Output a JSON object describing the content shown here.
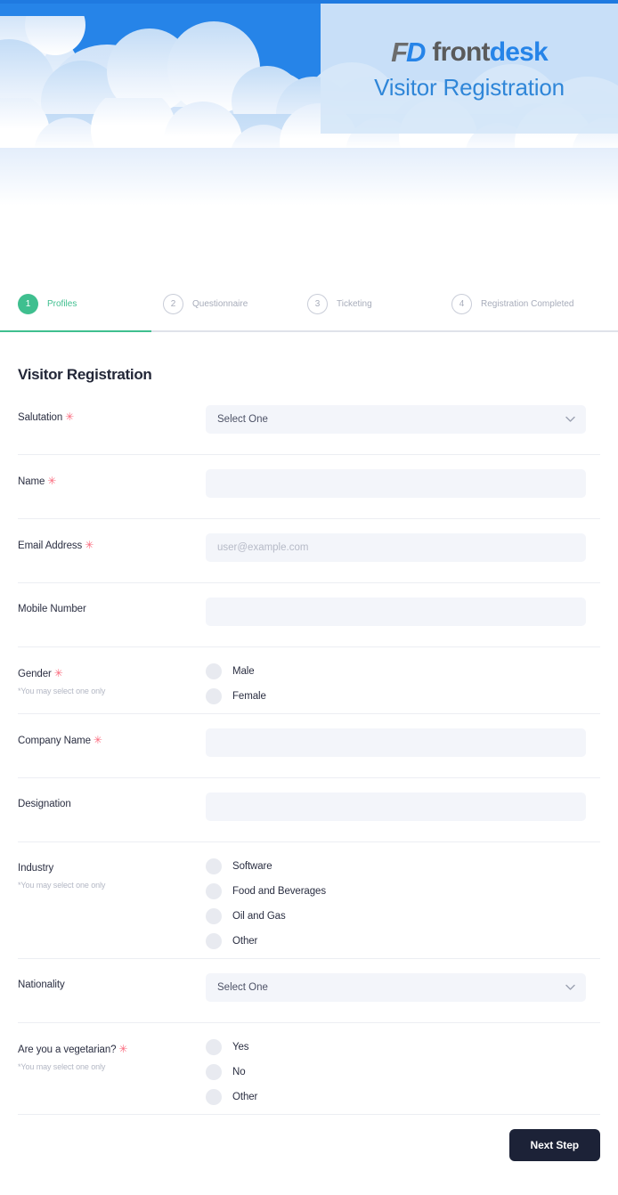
{
  "header": {
    "logo_fd_f": "F",
    "logo_fd_d": "D",
    "logo_front": "front",
    "logo_desk": "desk",
    "subtitle": "Visitor Registration",
    "sky_color": "#2684e8",
    "panel_color": "#d6e7f8",
    "brand_blue": "#2684e8",
    "brand_gray": "#5a5a5a"
  },
  "stepper": {
    "active_color": "#3fbf8f",
    "idle_color": "#a7acba",
    "steps": [
      {
        "number": "1",
        "label": "Profiles",
        "state": "active"
      },
      {
        "number": "2",
        "label": "Questionnaire",
        "state": "idle"
      },
      {
        "number": "3",
        "label": "Ticketing",
        "state": "idle"
      },
      {
        "number": "4",
        "label": "Registration Completed",
        "state": "idle"
      }
    ]
  },
  "form": {
    "title": "Visitor Registration",
    "required_mark": "✳",
    "hint_select_one": "*You may select one only",
    "select_placeholder": "Select One",
    "fields": {
      "salutation": {
        "label": "Salutation",
        "value": "Select One"
      },
      "name": {
        "label": "Name",
        "value": "",
        "placeholder": ""
      },
      "email": {
        "label": "Email Address",
        "value": "",
        "placeholder": "user@example.com"
      },
      "mobile": {
        "label": "Mobile Number",
        "value": "",
        "placeholder": ""
      },
      "gender": {
        "label": "Gender",
        "hint": "*You may select one only",
        "options": [
          "Male",
          "Female"
        ]
      },
      "company": {
        "label": "Company Name",
        "value": "",
        "placeholder": ""
      },
      "designation": {
        "label": "Designation",
        "value": "",
        "placeholder": ""
      },
      "industry": {
        "label": "Industry",
        "hint": "*You may select one only",
        "options": [
          "Software",
          "Food and Beverages",
          "Oil and Gas",
          "Other"
        ]
      },
      "nationality": {
        "label": "Nationality",
        "value": "Select One"
      },
      "vegetarian": {
        "label": "Are you a vegetarian?",
        "hint": "*You may select one only",
        "options": [
          "Yes",
          "No",
          "Other"
        ]
      }
    }
  },
  "footer": {
    "next_label": "Next Step",
    "button_color": "#1c2237"
  }
}
